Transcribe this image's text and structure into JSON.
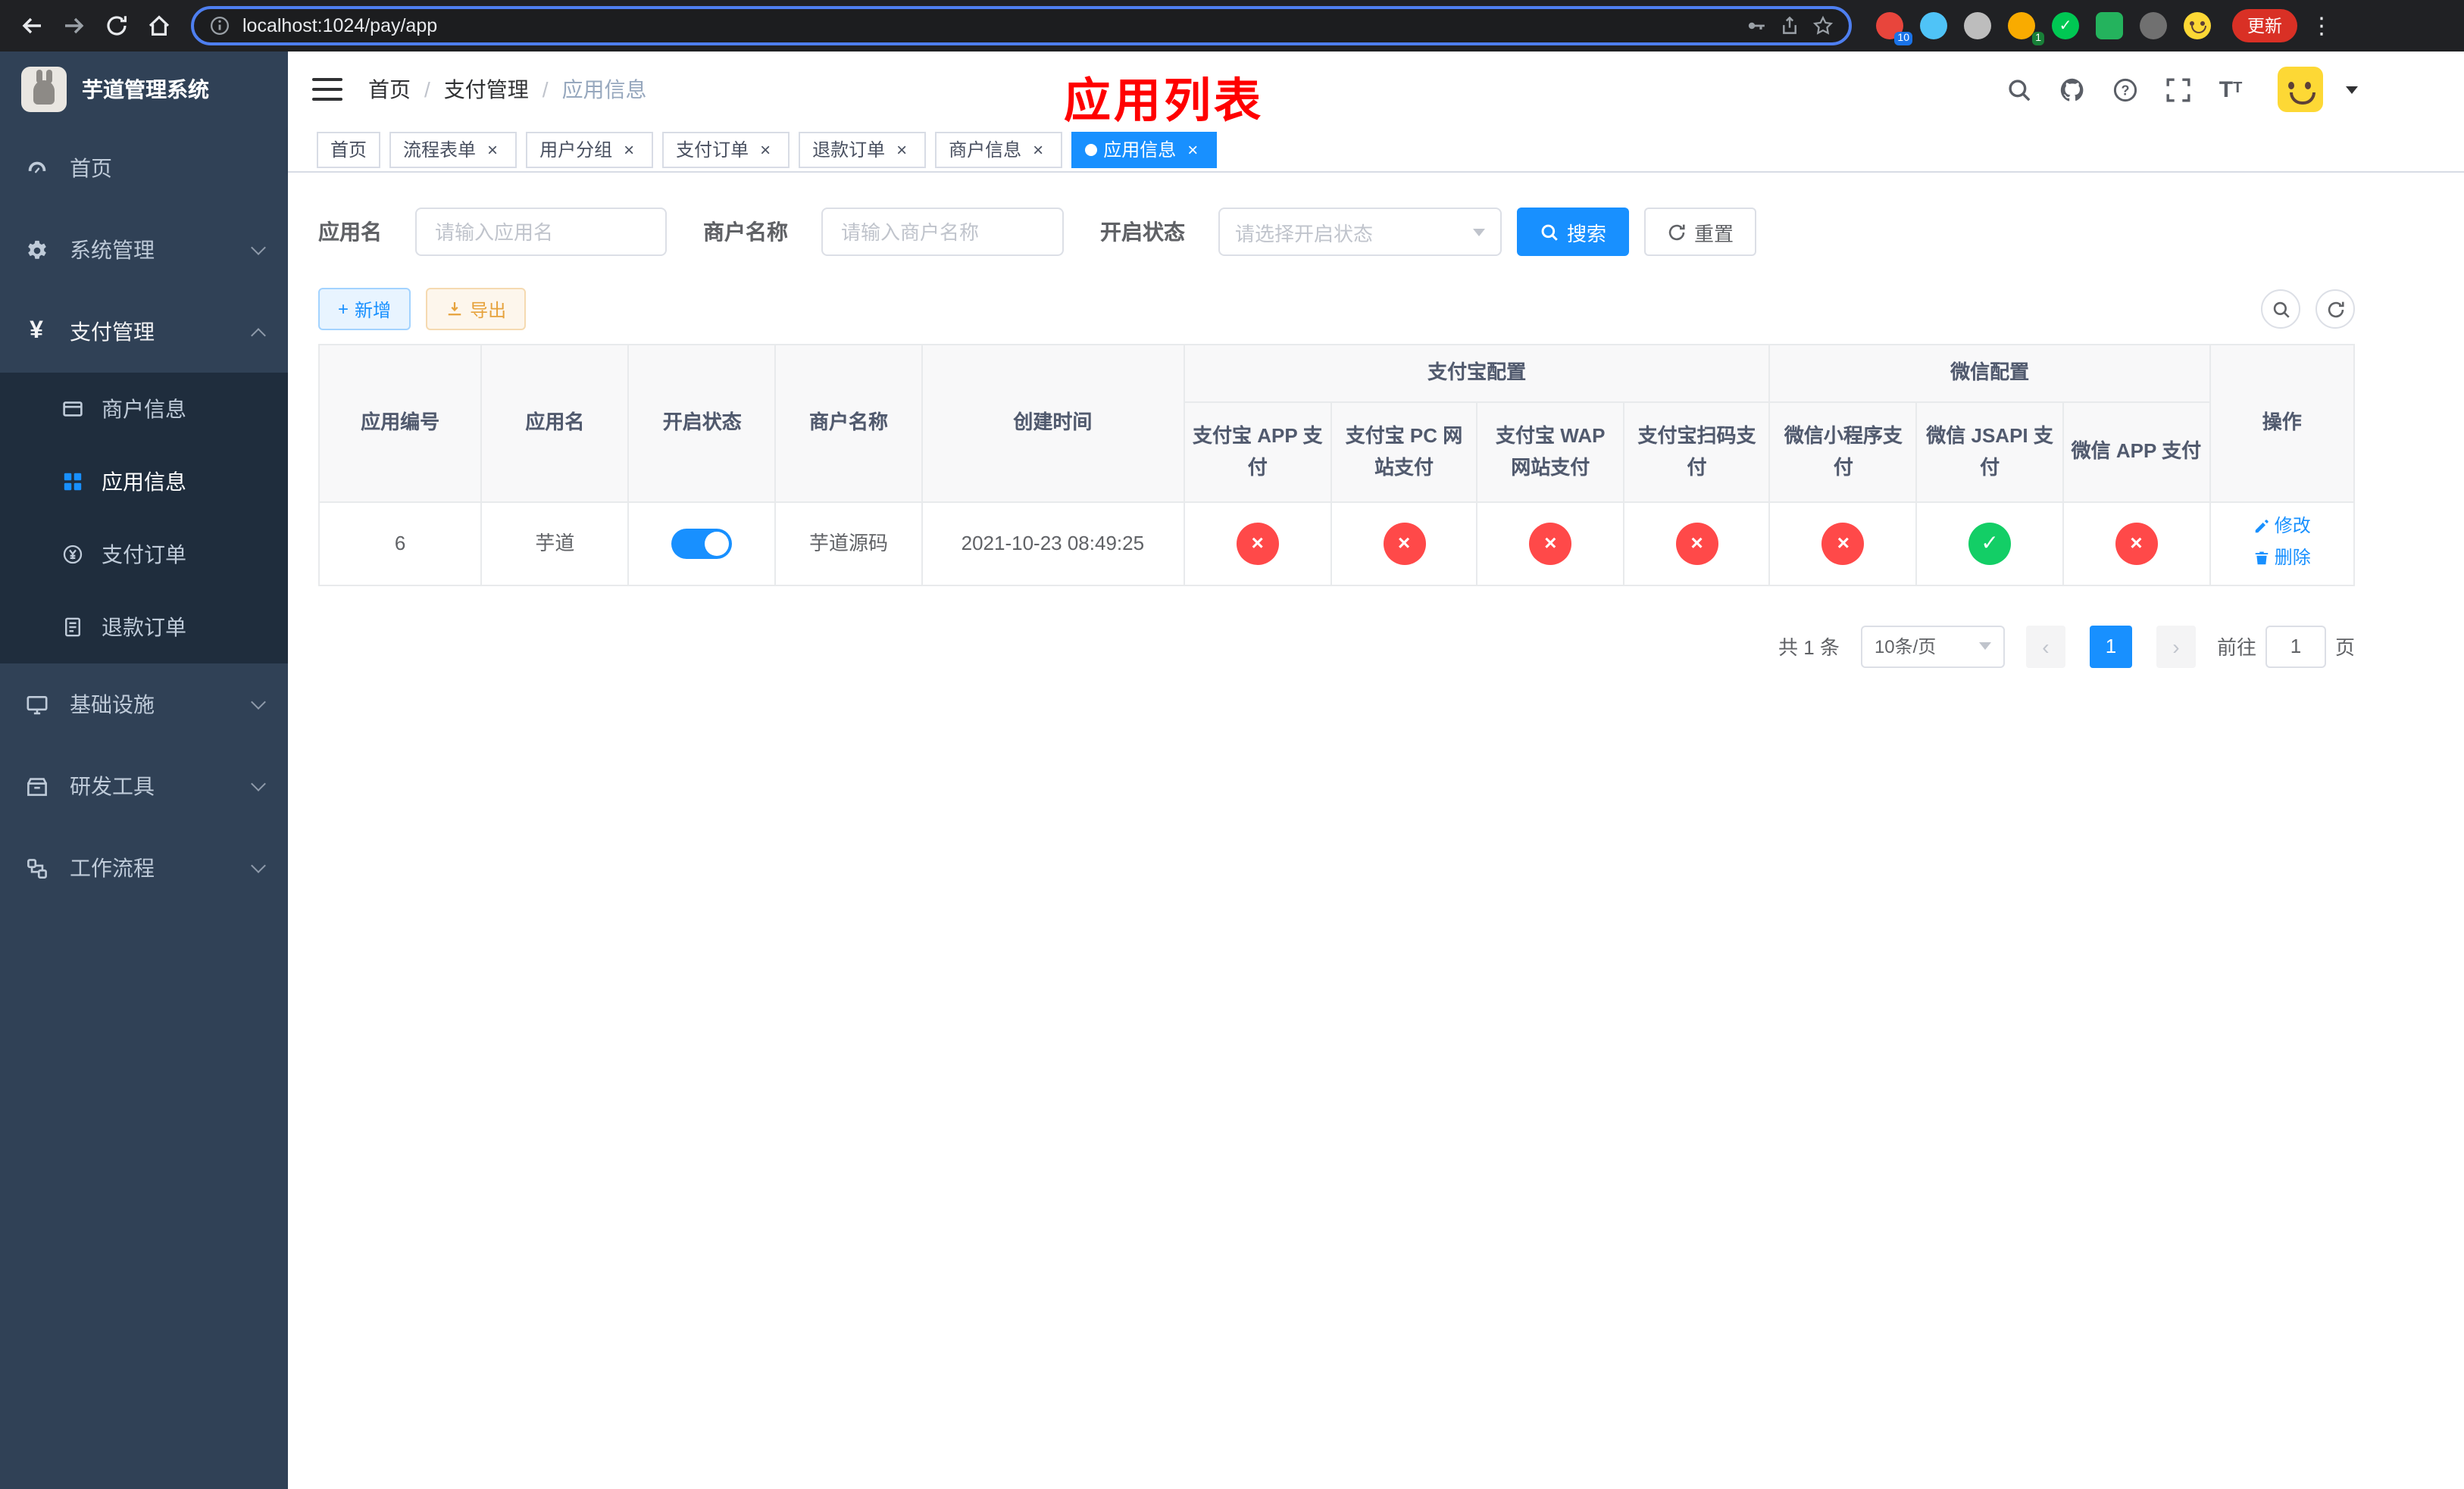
{
  "browser": {
    "url": "localhost:1024/pay/app",
    "update_button": "更新",
    "ext_badge_count": "10",
    "profile_badge_count": "1"
  },
  "sidebar": {
    "title": "芋道管理系统",
    "menu": [
      {
        "label": "首页"
      },
      {
        "label": "系统管理"
      },
      {
        "label": "支付管理"
      },
      {
        "label": "基础设施"
      },
      {
        "label": "研发工具"
      },
      {
        "label": "工作流程"
      }
    ],
    "submenu": [
      {
        "label": "商户信息"
      },
      {
        "label": "应用信息"
      },
      {
        "label": "支付订单"
      },
      {
        "label": "退款订单"
      }
    ]
  },
  "navbar": {
    "breadcrumb": [
      "首页",
      "支付管理",
      "应用信息"
    ],
    "overlay_title": "应用列表"
  },
  "tabs": [
    {
      "label": "首页"
    },
    {
      "label": "流程表单"
    },
    {
      "label": "用户分组"
    },
    {
      "label": "支付订单"
    },
    {
      "label": "退款订单"
    },
    {
      "label": "商户信息"
    },
    {
      "label": "应用信息"
    }
  ],
  "filters": {
    "app_name_label": "应用名",
    "app_name_placeholder": "请输入应用名",
    "merchant_label": "商户名称",
    "merchant_placeholder": "请输入商户名称",
    "status_label": "开启状态",
    "status_placeholder": "请选择开启状态",
    "search_button": "搜索",
    "reset_button": "重置"
  },
  "toolbar": {
    "add_button": "新增",
    "export_button": "导出"
  },
  "table": {
    "columns": [
      "应用编号",
      "应用名",
      "开启状态",
      "商户名称",
      "创建时间"
    ],
    "group_alipay": "支付宝配置",
    "group_wechat": "微信配置",
    "alipay_columns": [
      "支付宝 APP 支付",
      "支付宝 PC 网站支付",
      "支付宝 WAP 网站支付",
      "支付宝扫码支付"
    ],
    "wechat_columns": [
      "微信小程序支付",
      "微信 JSAPI 支付",
      "微信 APP 支付"
    ],
    "op_column": "操作",
    "row": {
      "id": "6",
      "name": "芋道",
      "enabled": true,
      "merchant": "芋道源码",
      "created_at": "2021-10-23 08:49:25",
      "configs": [
        false,
        false,
        false,
        false,
        false,
        true,
        false
      ],
      "edit": "修改",
      "delete": "删除"
    }
  },
  "pagination": {
    "total": "共 1 条",
    "page_size": "10条/页",
    "current_page": "1",
    "goto_label": "前往",
    "goto_value": "1",
    "goto_unit": "页"
  },
  "colors": {
    "primary": "#1890ff",
    "success": "#13ce66",
    "danger": "#ff4949",
    "warning": "#e6a23c"
  }
}
